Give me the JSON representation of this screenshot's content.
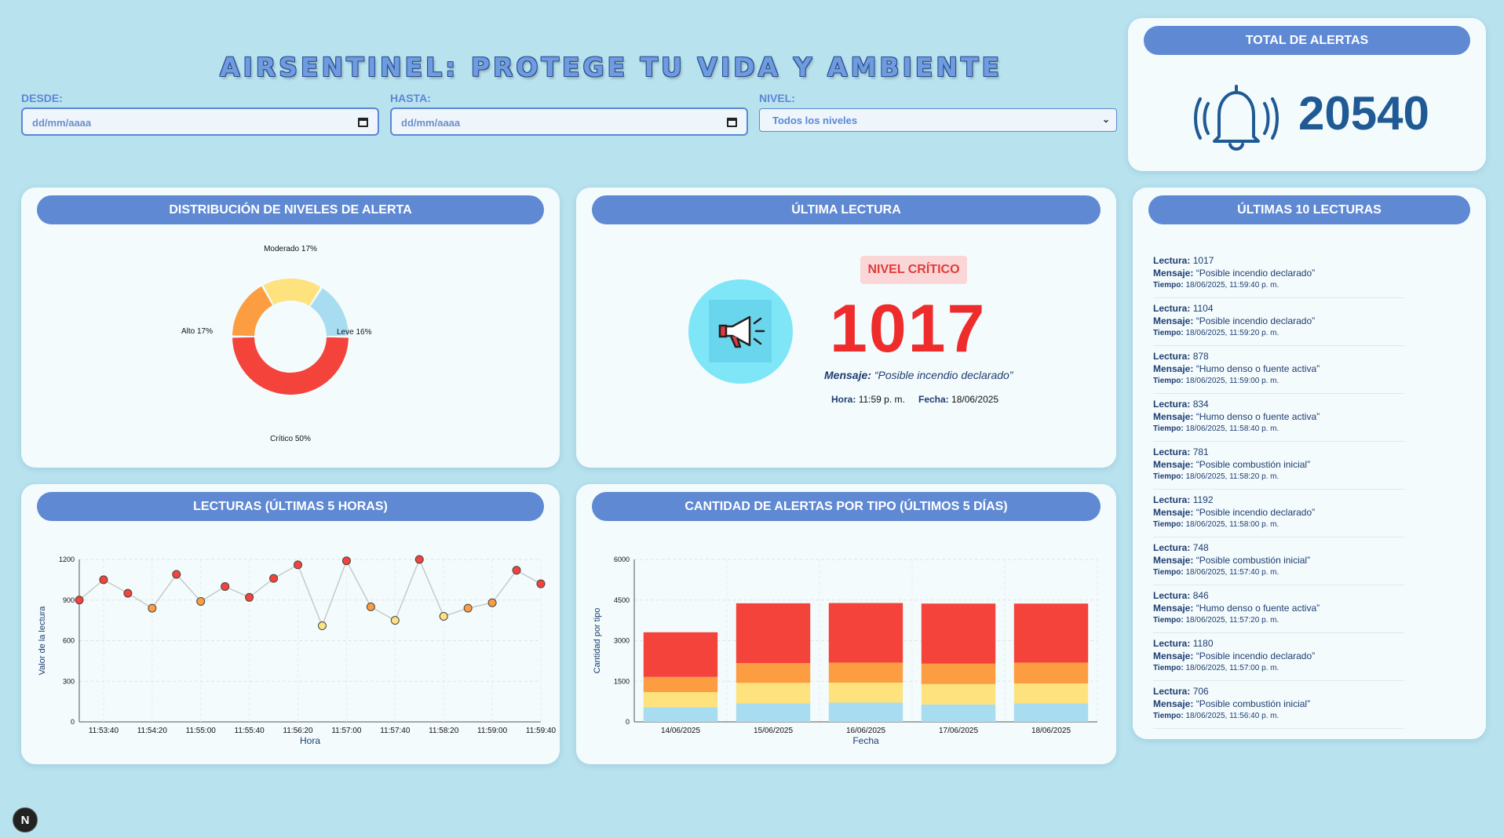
{
  "header": {
    "title": "AIRSENTINEL: PROTEGE TU VIDA Y AMBIENTE"
  },
  "filters": {
    "desde_label": "DESDE:",
    "desde_value": "dd/mm/aaaa",
    "hasta_label": "HASTA:",
    "hasta_value": "dd/mm/aaaa",
    "nivel_label": "NIVEL:",
    "nivel_value": "Todos los niveles"
  },
  "total": {
    "title": "TOTAL DE ALERTAS",
    "value": "20540",
    "icon": "bell-ringing-icon"
  },
  "distribution": {
    "title": "DISTRIBUCIÓN DE NIVELES DE ALERTA",
    "chart_data": {
      "type": "pie",
      "donut": true,
      "slices": [
        {
          "label": "Crítico 50%",
          "value": 50,
          "color": "#f4433b"
        },
        {
          "label": "Alto 17%",
          "value": 17,
          "color": "#fb9d40"
        },
        {
          "label": "Moderado 17%",
          "value": 17,
          "color": "#fde27e"
        },
        {
          "label": "Leve 16%",
          "value": 16,
          "color": "#a8dcf0"
        }
      ]
    }
  },
  "last_reading": {
    "title": "ÚLTIMA LECTURA",
    "badge": "NIVEL CRÍTICO",
    "value": "1017",
    "msg_label": "Mensaje:",
    "msg_text": "“Posible incendio declarado”",
    "hora_label": "Hora:",
    "hora_value": "11:59 p. m.",
    "fecha_label": "Fecha:",
    "fecha_value": "18/06/2025",
    "icon": "megaphone-icon"
  },
  "last10": {
    "title": "ÚLTIMAS 10 LECTURAS",
    "lectura_label": "Lectura:",
    "mensaje_label": "Mensaje:",
    "tiempo_label": "Tiempo:",
    "items": [
      {
        "lectura": "1017",
        "mensaje": "“Posible incendio declarado”",
        "tiempo": "18/06/2025, 11:59:40 p. m."
      },
      {
        "lectura": "1104",
        "mensaje": "“Posible incendio declarado”",
        "tiempo": "18/06/2025, 11:59:20 p. m."
      },
      {
        "lectura": "878",
        "mensaje": "“Humo denso o fuente activa”",
        "tiempo": "18/06/2025, 11:59:00 p. m."
      },
      {
        "lectura": "834",
        "mensaje": "“Humo denso o fuente activa”",
        "tiempo": "18/06/2025, 11:58:40 p. m."
      },
      {
        "lectura": "781",
        "mensaje": "“Posible combustión inicial”",
        "tiempo": "18/06/2025, 11:58:20 p. m."
      },
      {
        "lectura": "1192",
        "mensaje": "“Posible incendio declarado”",
        "tiempo": "18/06/2025, 11:58:00 p. m."
      },
      {
        "lectura": "748",
        "mensaje": "“Posible combustión inicial”",
        "tiempo": "18/06/2025, 11:57:40 p. m."
      },
      {
        "lectura": "846",
        "mensaje": "“Humo denso o fuente activa”",
        "tiempo": "18/06/2025, 11:57:20 p. m."
      },
      {
        "lectura": "1180",
        "mensaje": "“Posible incendio declarado”",
        "tiempo": "18/06/2025, 11:57:00 p. m."
      },
      {
        "lectura": "706",
        "mensaje": "“Posible combustión inicial”",
        "tiempo": "18/06/2025, 11:56:40 p. m."
      }
    ]
  },
  "readings_chart": {
    "title": "LECTURAS (ÚLTIMAS 5 HORAS)",
    "chart_data": {
      "type": "line",
      "xlabel": "Hora",
      "ylabel": "Valor de la lectura",
      "ylim": [
        0,
        1200
      ],
      "yticks": [
        0,
        300,
        600,
        900,
        1200
      ],
      "xticks": [
        "11:53:40",
        "11:54:20",
        "11:55:00",
        "11:55:40",
        "11:56:20",
        "11:57:00",
        "11:57:40",
        "11:58:20",
        "11:59:00",
        "11:59:40"
      ],
      "values": [
        900,
        1050,
        950,
        840,
        1090,
        890,
        1000,
        920,
        1060,
        1160,
        710,
        1190,
        850,
        750,
        1200,
        780,
        840,
        880,
        1120,
        1020
      ],
      "colors": [
        "#f4433b",
        "#f4433b",
        "#f4433b",
        "#fb9d40",
        "#f4433b",
        "#fb9d40",
        "#f4433b",
        "#f4433b",
        "#f4433b",
        "#f4433b",
        "#fde27e",
        "#f4433b",
        "#fb9d40",
        "#fde27e",
        "#f4433b",
        "#fde27e",
        "#fb9d40",
        "#fb9d40",
        "#f4433b",
        "#f4433b"
      ],
      "grid": true
    }
  },
  "alerts_by_type": {
    "title": "CANTIDAD DE ALERTAS POR TIPO (ÚLTIMOS 5 DÍAS)",
    "chart_data": {
      "type": "bar",
      "stacked": true,
      "xlabel": "Fecha",
      "ylabel": "Cantidad por tipo",
      "ylim": [
        0,
        6000
      ],
      "yticks": [
        0,
        1500,
        3000,
        4500,
        6000
      ],
      "categories": [
        "14/06/2025",
        "15/06/2025",
        "16/06/2025",
        "17/06/2025",
        "18/06/2025"
      ],
      "series": [
        {
          "color": "#a8dcf0",
          "values": [
            540,
            690,
            710,
            640,
            690
          ]
        },
        {
          "color": "#fde27e",
          "values": [
            560,
            750,
            740,
            760,
            730
          ]
        },
        {
          "color": "#fb9d40",
          "values": [
            560,
            730,
            740,
            750,
            770
          ]
        },
        {
          "color": "#f4433b",
          "values": [
            1650,
            2210,
            2200,
            2220,
            2180
          ]
        }
      ],
      "grid": true
    }
  },
  "nextjs_badge": "N"
}
